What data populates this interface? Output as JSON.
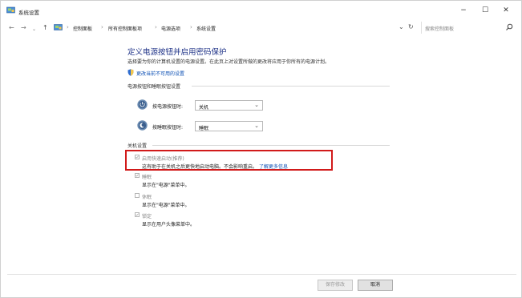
{
  "window": {
    "title": "系统设置",
    "minimize_glyph": "−",
    "maximize_glyph": "☐",
    "close_glyph": "✕"
  },
  "nav": {
    "back_glyph": "←",
    "forward_glyph": "→",
    "recent_glyph": "⌄",
    "up_glyph": "↑",
    "breadcrumb": [
      "控制面板",
      "所有控制面板项",
      "电源选项",
      "系统设置"
    ],
    "dropdown_glyph": "⌄",
    "refresh_glyph": "↻",
    "search_placeholder": "搜索控制面板"
  },
  "page": {
    "heading": "定义电源按钮并启用密码保护",
    "description": "选择要为你的计算机设置的电源设置。在此页上对设置所做的更改将应用于你所有的电源计划。",
    "change_link": "更改当前不可用的设置"
  },
  "buttons_section": {
    "title": "电源按钮和睡眠按钮设置",
    "rows": [
      {
        "label": "按电源按钮时:",
        "value": "关机"
      },
      {
        "label": "按睡眠按钮时:",
        "value": "睡眠"
      }
    ]
  },
  "shutdown_section": {
    "title": "关机设置",
    "items": [
      {
        "label": "启用快速启动(推荐)",
        "desc": "这有助于在关机之后更快地启动电脑。不会影响重启。",
        "link": "了解更多信息",
        "checked": true
      },
      {
        "label": "睡眠",
        "desc": "显示在\"电源\"菜单中。",
        "checked": true
      },
      {
        "label": "休眠",
        "desc": "显示在\"电源\"菜单中。",
        "checked": false
      },
      {
        "label": "锁定",
        "desc": "显示在用户头像菜单中。",
        "checked": true
      }
    ]
  },
  "footer": {
    "save_label": "保存修改",
    "cancel_label": "取消"
  },
  "colors": {
    "heading": "#1e3287",
    "link": "#0b4fb4",
    "highlight": "#d11a1a"
  }
}
